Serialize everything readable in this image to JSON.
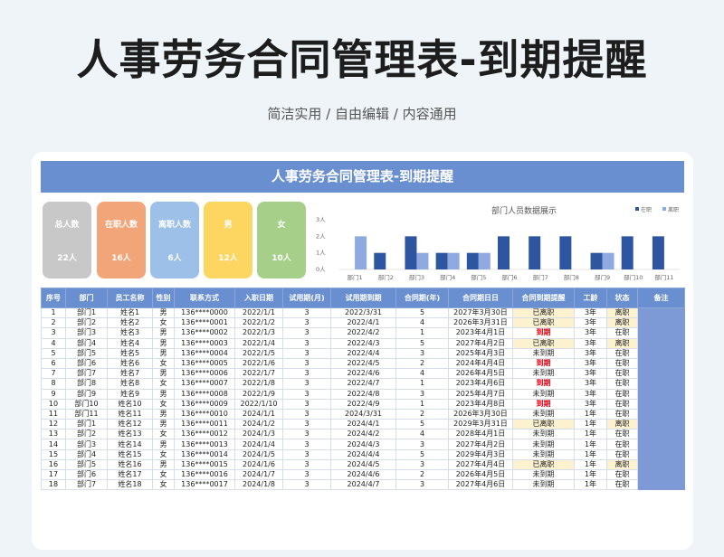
{
  "hero": {
    "title": "人事劳务合同管理表-到期提醒",
    "subtitle": "简洁实用 / 自由编辑 / 内容通用"
  },
  "sheet": {
    "banner": "人事劳务合同管理表-到期提醒",
    "stats": [
      {
        "label": "总人数",
        "value": "22人",
        "color": "#c8c8c8"
      },
      {
        "label": "在职人数",
        "value": "16人",
        "color": "#f3a57a"
      },
      {
        "label": "离职人数",
        "value": "6人",
        "color": "#9cc0e8"
      },
      {
        "label": "男",
        "value": "12人",
        "color": "#fdd561"
      },
      {
        "label": "女",
        "value": "10人",
        "color": "#a6d08a"
      }
    ],
    "columns": [
      "序号",
      "部门",
      "员工名称",
      "性别",
      "联系方式",
      "入职日期",
      "试用期(月)",
      "试用期到期",
      "合同期(年)",
      "合同期日日",
      "合同到期提醒",
      "工龄",
      "状态",
      "备注"
    ],
    "rows": [
      [
        "1",
        "部门1",
        "姓名1",
        "男",
        "136****0000",
        "2022/1/1",
        "3",
        "2022/3/31",
        "5",
        "2027年3月30日",
        "已离职",
        "3年",
        "离职",
        ""
      ],
      [
        "2",
        "部门2",
        "姓名2",
        "女",
        "136****0001",
        "2022/1/2",
        "3",
        "2022/4/1",
        "4",
        "2026年3月31日",
        "已离职",
        "3年",
        "离职",
        ""
      ],
      [
        "3",
        "部门3",
        "姓名3",
        "男",
        "136****0002",
        "2022/1/3",
        "3",
        "2022/4/2",
        "1",
        "2023年4月1日",
        "到期",
        "3年",
        "在职",
        ""
      ],
      [
        "4",
        "部门4",
        "姓名4",
        "男",
        "136****0003",
        "2022/1/4",
        "3",
        "2022/4/3",
        "5",
        "2027年4月2日",
        "已离职",
        "3年",
        "离职",
        ""
      ],
      [
        "5",
        "部门5",
        "姓名5",
        "男",
        "136****0004",
        "2022/1/5",
        "3",
        "2022/4/4",
        "3",
        "2025年4月3日",
        "未到期",
        "3年",
        "在职",
        ""
      ],
      [
        "6",
        "部门6",
        "姓名6",
        "女",
        "136****0005",
        "2022/1/6",
        "3",
        "2022/4/5",
        "2",
        "2024年4月4日",
        "到期",
        "3年",
        "在职",
        ""
      ],
      [
        "7",
        "部门7",
        "姓名7",
        "男",
        "136****0006",
        "2022/1/7",
        "3",
        "2022/4/6",
        "4",
        "2026年4月5日",
        "未到期",
        "3年",
        "在职",
        ""
      ],
      [
        "8",
        "部门8",
        "姓名8",
        "女",
        "136****0007",
        "2022/1/8",
        "3",
        "2022/4/7",
        "1",
        "2023年4月6日",
        "到期",
        "3年",
        "在职",
        ""
      ],
      [
        "9",
        "部门9",
        "姓名9",
        "男",
        "136****0008",
        "2022/1/9",
        "3",
        "2022/4/8",
        "3",
        "2025年4月7日",
        "未到期",
        "3年",
        "在职",
        ""
      ],
      [
        "10",
        "部门10",
        "姓名10",
        "女",
        "136****0009",
        "2022/1/10",
        "3",
        "2022/4/9",
        "1",
        "2023年4月8日",
        "到期",
        "3年",
        "在职",
        ""
      ],
      [
        "11",
        "部门11",
        "姓名11",
        "男",
        "136****0010",
        "2024/1/1",
        "3",
        "2024/3/31",
        "2",
        "2026年3月30日",
        "未到期",
        "1年",
        "在职",
        ""
      ],
      [
        "12",
        "部门1",
        "姓名12",
        "男",
        "136****0011",
        "2024/1/2",
        "3",
        "2024/4/1",
        "5",
        "2029年3月31日",
        "已离职",
        "1年",
        "离职",
        ""
      ],
      [
        "13",
        "部门2",
        "姓名13",
        "女",
        "136****0012",
        "2024/1/3",
        "3",
        "2024/4/2",
        "4",
        "2028年4月1日",
        "未到期",
        "1年",
        "在职",
        ""
      ],
      [
        "14",
        "部门3",
        "姓名14",
        "男",
        "136****0013",
        "2024/1/4",
        "3",
        "2024/4/3",
        "3",
        "2027年4月2日",
        "未到期",
        "1年",
        "在职",
        ""
      ],
      [
        "15",
        "部门4",
        "姓名15",
        "女",
        "136****0014",
        "2024/1/5",
        "3",
        "2024/4/4",
        "5",
        "2029年4月3日",
        "未到期",
        "1年",
        "在职",
        ""
      ],
      [
        "16",
        "部门5",
        "姓名16",
        "男",
        "136****0015",
        "2024/1/6",
        "3",
        "2024/4/5",
        "3",
        "2027年4月4日",
        "已离职",
        "1年",
        "离职",
        ""
      ],
      [
        "17",
        "部门6",
        "姓名17",
        "女",
        "136****0016",
        "2024/1/7",
        "3",
        "2024/4/6",
        "2",
        "2026年4月5日",
        "未到期",
        "1年",
        "在职",
        ""
      ],
      [
        "18",
        "部门7",
        "姓名18",
        "女",
        "136****0017",
        "2024/1/8",
        "3",
        "2024/4/7",
        "3",
        "2027年4月6日",
        "未到期",
        "1年",
        "在职",
        ""
      ]
    ],
    "reminder_styles": {
      "已离职": "yellow",
      "到期": "red",
      "未到期": "plain"
    },
    "status_styles": {
      "离职": "yellow",
      "在职": "plain"
    },
    "colors": {
      "primary": "#6a8fd0",
      "on_job_bar": "#2e55a0",
      "left_bar": "#8faae0",
      "alert_red": "#e60012",
      "highlight": "#fdf2cf"
    }
  },
  "chart_data": {
    "type": "bar",
    "title": "部门人员数据展示",
    "categories": [
      "部门1",
      "部门2",
      "部门3",
      "部门4",
      "部门5",
      "部门6",
      "部门7",
      "部门8",
      "部门9",
      "部门10",
      "部门11"
    ],
    "series": [
      {
        "name": "在职",
        "values": [
          0,
          1,
          2,
          1,
          1,
          2,
          2,
          2,
          1,
          2,
          2
        ]
      },
      {
        "name": "离职",
        "values": [
          2,
          0,
          1,
          1,
          1,
          0,
          0,
          0,
          1,
          0,
          0
        ]
      }
    ],
    "yticks": [
      "0人",
      "1人",
      "2人",
      "3人"
    ],
    "ylim": [
      0,
      3
    ],
    "legend": "top-right",
    "grid": false
  }
}
